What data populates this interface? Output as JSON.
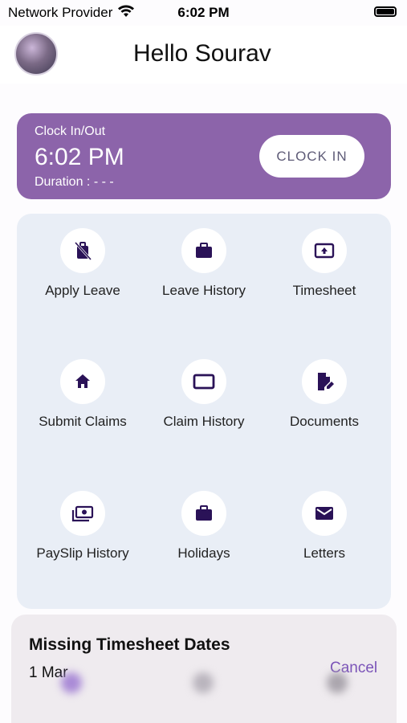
{
  "status_bar": {
    "carrier": "Network Provider",
    "time": "6:02 PM",
    "wifi_icon": "wifi-icon",
    "battery_icon": "battery-icon"
  },
  "header": {
    "greeting": "Hello Sourav",
    "avatar_icon": "avatar"
  },
  "clock_card": {
    "label": "Clock In/Out",
    "time": "6:02 PM",
    "duration": "Duration : - - -",
    "button_label": "CLOCK IN",
    "background_color": "#8c64aa"
  },
  "menu": {
    "items": [
      {
        "id": "apply-leave",
        "label": "Apply Leave",
        "icon": "luggage-off-icon"
      },
      {
        "id": "leave-history",
        "label": "Leave History",
        "icon": "briefcase-icon"
      },
      {
        "id": "timesheet",
        "label": "Timesheet",
        "icon": "upload-box-icon"
      },
      {
        "id": "submit-claims",
        "label": "Submit Claims",
        "icon": "home-icon"
      },
      {
        "id": "claim-history",
        "label": "Claim History",
        "icon": "rectangle-icon"
      },
      {
        "id": "documents",
        "label": "Documents",
        "icon": "document-edit-icon"
      },
      {
        "id": "payslip-history",
        "label": "PaySlip History",
        "icon": "money-icon"
      },
      {
        "id": "holidays",
        "label": "Holidays",
        "icon": "briefcase-icon"
      },
      {
        "id": "letters",
        "label": "Letters",
        "icon": "mail-icon"
      }
    ],
    "icon_color": "#2a1257",
    "card_color": "#e9eef6"
  },
  "missing_timesheet": {
    "title": "Missing Timesheet Dates",
    "date": "1 Mar",
    "cancel_label": "Cancel",
    "accent_color": "#7b54b8"
  }
}
